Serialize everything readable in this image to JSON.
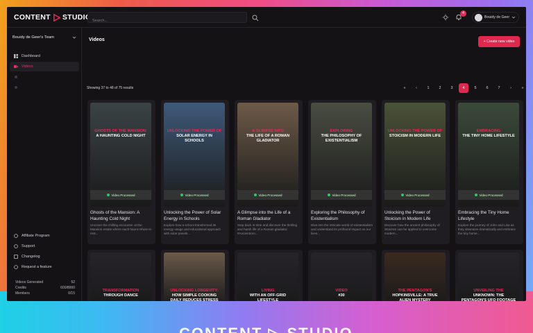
{
  "brand": {
    "name": "CONTENT",
    "name2": "STUDIO"
  },
  "search": {
    "placeholder": "Search..."
  },
  "notifications": {
    "count": "4"
  },
  "user": {
    "name": "Bouidy de Geer"
  },
  "team": {
    "name": "Bouidy de Geer's Team"
  },
  "nav": [
    {
      "label": "Dashboard",
      "icon": "dashboard-icon"
    },
    {
      "label": "Videos",
      "icon": "video-icon"
    },
    {
      "label": "",
      "icon": "settings-icon"
    },
    {
      "label": "",
      "icon": "blank-icon"
    }
  ],
  "bottom_nav": [
    {
      "label": "Affiliate Program",
      "icon": "affiliate-icon"
    },
    {
      "label": "Support",
      "icon": "support-icon"
    },
    {
      "label": "Changelog",
      "icon": "changelog-icon"
    },
    {
      "label": "Request a feature",
      "icon": "feature-icon"
    }
  ],
  "stats": [
    {
      "label": "Videos Generated",
      "value": "52"
    },
    {
      "label": "Credits",
      "value": "600/8000"
    },
    {
      "label": "Members",
      "value": "0/15"
    }
  ],
  "page": {
    "title": "Videos",
    "create_label": "+ Create new video",
    "results": "Showing 37 to 48 of 75 results"
  },
  "pagination": [
    "«",
    "‹",
    "1",
    "2",
    "3",
    "4",
    "5",
    "6",
    "7",
    "›",
    "»"
  ],
  "pagination_active": "4",
  "cards": [
    {
      "overlay1": "GHOSTS OF THE MANSION:",
      "overlay2": "A HAUNTING COLD NIGHT",
      "status": "Video Processed",
      "title": "Ghosts of the Mansion: A Haunting Cold Night",
      "desc": "Uncover the chilling encounter at the Mansion estate where each haunt refuse to rest...",
      "bg": "#3b4346"
    },
    {
      "overlay1": "UNLOCKING THE POWER OF",
      "overlay2": "SOLAR ENERGY IN SCHOOLS",
      "status": "Video Processed",
      "title": "Unlocking the Power of Solar Energy in Schools",
      "desc": "Explore how a school transformed its energy usage and educational approach with solar panels...",
      "bg": "#3f5a7a"
    },
    {
      "overlay1": "A GLIMPSE INTO",
      "overlay2": "THE LIFE OF A ROMAN GLADIATOR",
      "status": "Video Processed",
      "title": "A Glimpse into the Life of a Roman Gladiator",
      "desc": "Step back in time and discover the thrilling and harsh life of a Roman gladiator. #Ancientrom...",
      "bg": "#6d5a48"
    },
    {
      "overlay1": "EXPLORING",
      "overlay2": "THE PHILOSOPHY OF EXISTENTIALISM",
      "status": "Video Processed",
      "title": "Exploring the Philosophy of Existentialism",
      "desc": "Dive into the intricate world of existentialism and understand its profound impact on our lives...",
      "bg": "#4a4d42"
    },
    {
      "overlay1": "UNLOCKING THE POWER OF",
      "overlay2": "STOICISM IN MODERN LIFE",
      "status": "Video Processed",
      "title": "Unlocking the Power of Stoicism in Modern Life",
      "desc": "Discover how the ancient philosophy of Stoicism can be applied to overcome modern...",
      "bg": "#4a5238"
    },
    {
      "overlay1": "EMBRACING",
      "overlay2": "THE TINY HOME LIFESTYLE",
      "status": "Video Processed",
      "title": "Embracing the Tiny Home Lifestyle",
      "desc": "Explore the journey of John and Lisa as they downsize dramatically and embrace the tiny home...",
      "bg": "#3b4a3a"
    }
  ],
  "cards_row2": [
    {
      "overlay1": "TRANSFORMATION",
      "overlay2": "THROUGH DANCE",
      "bg": "#26232a"
    },
    {
      "overlay1": "UNLOCKING LONGEVITY:",
      "overlay2": "HOW SIMPLE COOKING DAILY REDUCES STRESS",
      "bg": "#6a5a4a"
    },
    {
      "overlay1": "LIVING",
      "overlay2": "WITH AN OFF-GRID LIFESTYLE",
      "bg": "#26232a"
    },
    {
      "overlay1": "VIDEO",
      "overlay2": "#30",
      "bg": "#26232a"
    },
    {
      "overlay1": "THE PENTAGON'S",
      "overlay2": "HOPKINSVILLE: A TRUE ALIEN MYSTERY",
      "bg": "#3a2a20"
    },
    {
      "overlay1": "UNVEILING THE",
      "overlay2": "UNKNOWN: THE PENTAGON'S UFO FOOTAGE",
      "bg": "#26232a"
    }
  ],
  "colors": {
    "accent": "#e0284f",
    "bg": "#141214"
  }
}
